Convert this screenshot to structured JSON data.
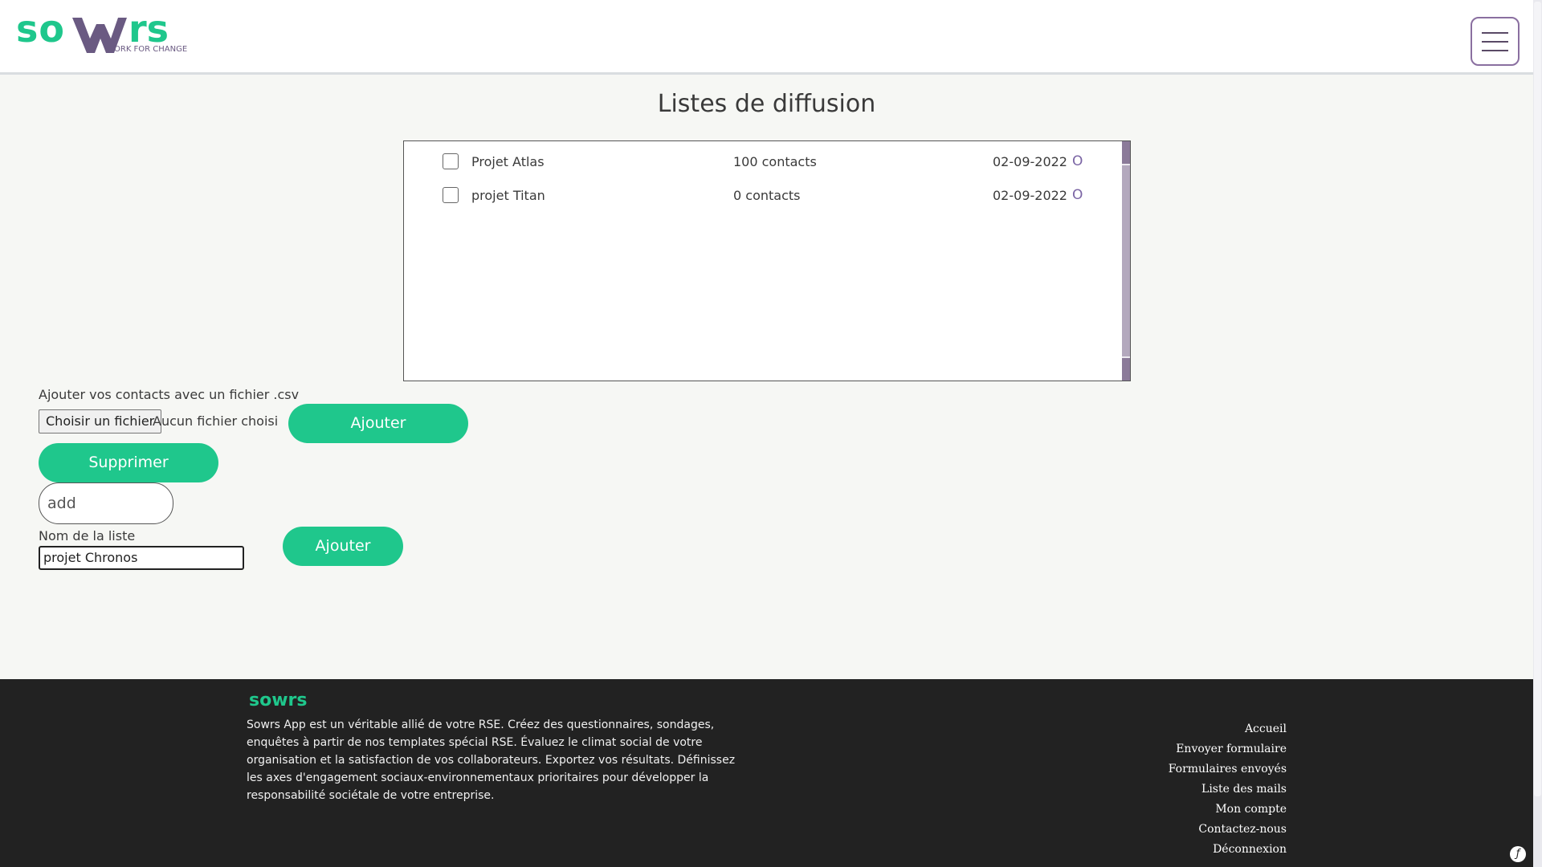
{
  "brand": {
    "logo_text": "sowrs",
    "tagline": "ORK FOR CHANGE",
    "colors": {
      "green": "#1fc78c",
      "purple": "#7a64a4",
      "dark": "#222222"
    }
  },
  "header": {
    "menu_icon": "hamburger-icon"
  },
  "page": {
    "title": "Listes de diffusion"
  },
  "lists": [
    {
      "name": "Projet Atlas",
      "count": "100 contacts",
      "date": "02-09-2022",
      "delete_glyph": "O"
    },
    {
      "name": "projet Titan",
      "count": "0 contacts",
      "date": "02-09-2022",
      "delete_glyph": "O"
    }
  ],
  "import": {
    "label": "Ajouter vos contacts avec un fichier .csv",
    "file_button": "Choisir un fichier",
    "file_status": "Aucun fichier choisi",
    "submit_label": "Ajouter"
  },
  "actions": {
    "delete_label": "Supprimer",
    "add_placeholder": "add"
  },
  "new_list": {
    "label": "Nom de la liste",
    "value": "projet Chronos",
    "submit_label": "Ajouter"
  },
  "footer": {
    "logo_text": "sowrs",
    "description": "Sowrs App est un véritable allié de votre RSE. Créez des questionnaires, sondages, enquêtes à partir de nos templates spécial RSE. Évaluez le climat social de votre organisation et la satisfaction de vos collaborateurs. Exportez vos résultats. Définissez les axes d'engagement sociaux-environnementaux prioritaires pour développer la responsabilité sociétale de votre entreprise.",
    "links": [
      "Accueil",
      "Envoyer formulaire",
      "Formulaires envoyés",
      "Liste des mails",
      "Mon compte",
      "Contactez-nous",
      "Déconnexion"
    ]
  }
}
